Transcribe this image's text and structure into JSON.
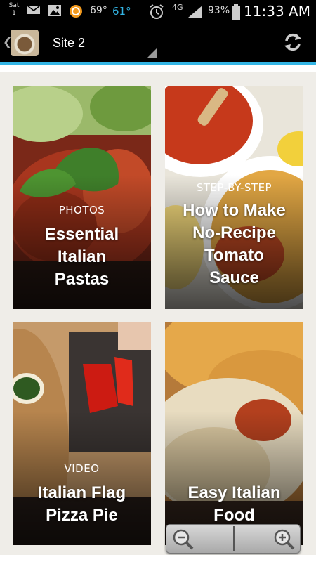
{
  "status_bar": {
    "day": "Sat",
    "date": "1",
    "temp1": "69°",
    "temp2": "61°",
    "network": "4G",
    "battery": "93%",
    "time": "11:33 AM"
  },
  "action_bar": {
    "title": "Site 2",
    "icons": [
      "back-chevron-icon",
      "app-logo",
      "dropdown-caret-icon",
      "refresh-icon"
    ]
  },
  "cards": [
    {
      "label": "PHOTOS",
      "title_lines": [
        "Essential",
        "Italian",
        "Pastas"
      ]
    },
    {
      "label": "STEP-BY-STEP",
      "title_lines": [
        "How to Make",
        "No-Recipe",
        "Tomato",
        "Sauce"
      ]
    },
    {
      "label": "VIDEO",
      "title_lines": [
        "Italian Flag",
        "Pizza Pie"
      ]
    },
    {
      "label": "",
      "title_lines": [
        "Easy Italian",
        "Food"
      ]
    }
  ],
  "zoom_control": {
    "icons": [
      "zoom-out-icon",
      "zoom-in-icon"
    ]
  },
  "colors": {
    "accent": "#33b5e5",
    "background": "#efede8"
  }
}
